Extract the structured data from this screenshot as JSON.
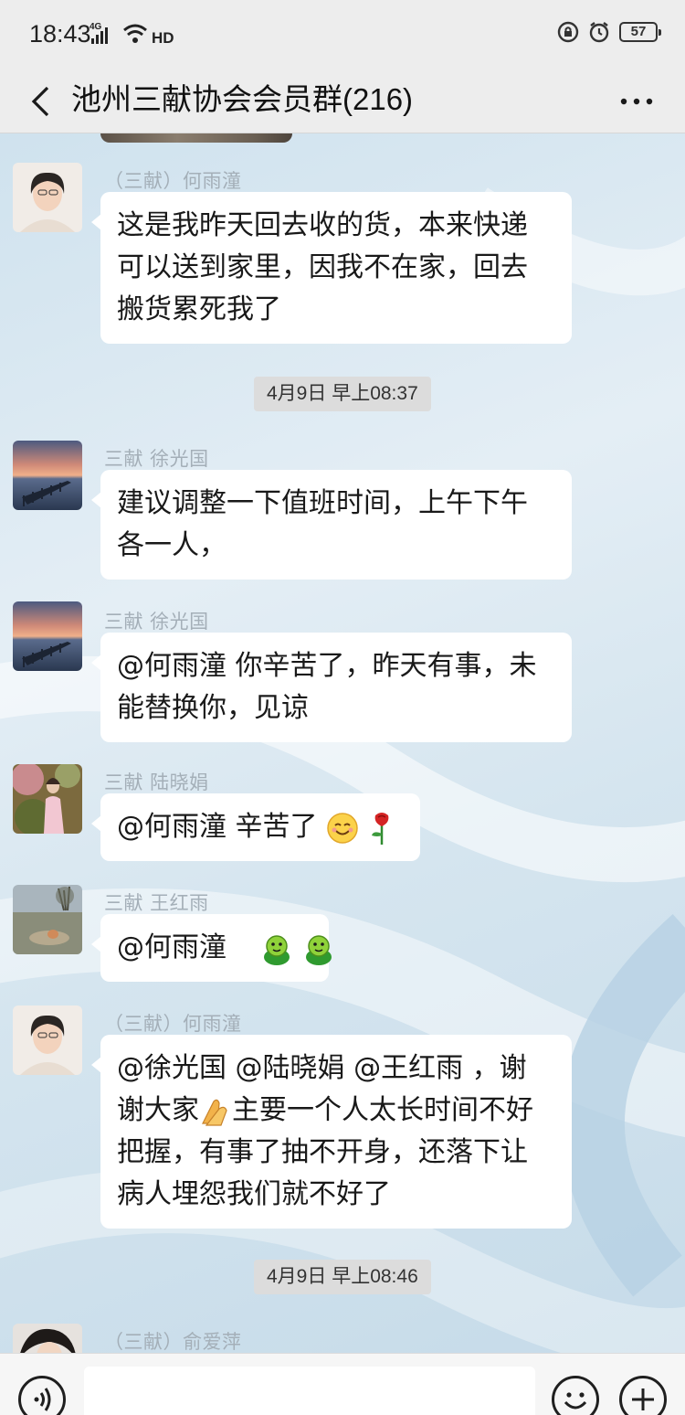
{
  "status_bar": {
    "time": "18:43",
    "network": "4G",
    "hd": "HD",
    "battery": "57"
  },
  "header": {
    "title": "池州三献协会会员群(216)"
  },
  "messages": [
    {
      "sender": "（三献）何雨潼",
      "lines": [
        "这是我昨天回去收的货，本来快递",
        "可以送到家里，因我不在家，回去",
        "搬货累死我了"
      ]
    },
    {
      "timestamp": "4月9日 早上08:37"
    },
    {
      "sender": "三献 徐光国",
      "lines": [
        "建议调整一下值班时间，上午下午",
        "各一人，"
      ]
    },
    {
      "sender": "三献 徐光国",
      "lines": [
        "@何雨潼  你辛苦了，昨天有事，未",
        "能替换你，见谅"
      ]
    },
    {
      "sender": "三献 陆晓娟",
      "text": "@何雨潼  辛苦了",
      "emojis": [
        "smile-emoji",
        "rose-emoji"
      ]
    },
    {
      "sender": "三献 王红雨",
      "text": "@何雨潼",
      "emojis": [
        "frog-emoji",
        "frog-emoji"
      ]
    },
    {
      "sender": "（三献）何雨潼",
      "lines": [
        "@徐光国 @陆晓娟 @王红雨 ，谢",
        "谢大家",
        "主要一个人太长时间不好",
        "把握，有事了抽不开身，还落下让",
        "病人埋怨我们就不好了"
      ]
    },
    {
      "timestamp": "4月9日 早上08:46"
    },
    {
      "sender": "（三献）俞爱萍"
    }
  ],
  "icons": {
    "back": "chevron-left-icon",
    "more": "more-dots-icon",
    "voice": "voice-icon",
    "emoji": "emoji-icon",
    "plus": "plus-icon"
  },
  "colors": {
    "bubble": "#ffffff",
    "header_bg": "#ededed",
    "sender_name": "#a4afb8",
    "timestamp_bg": "#dcdcdc"
  }
}
